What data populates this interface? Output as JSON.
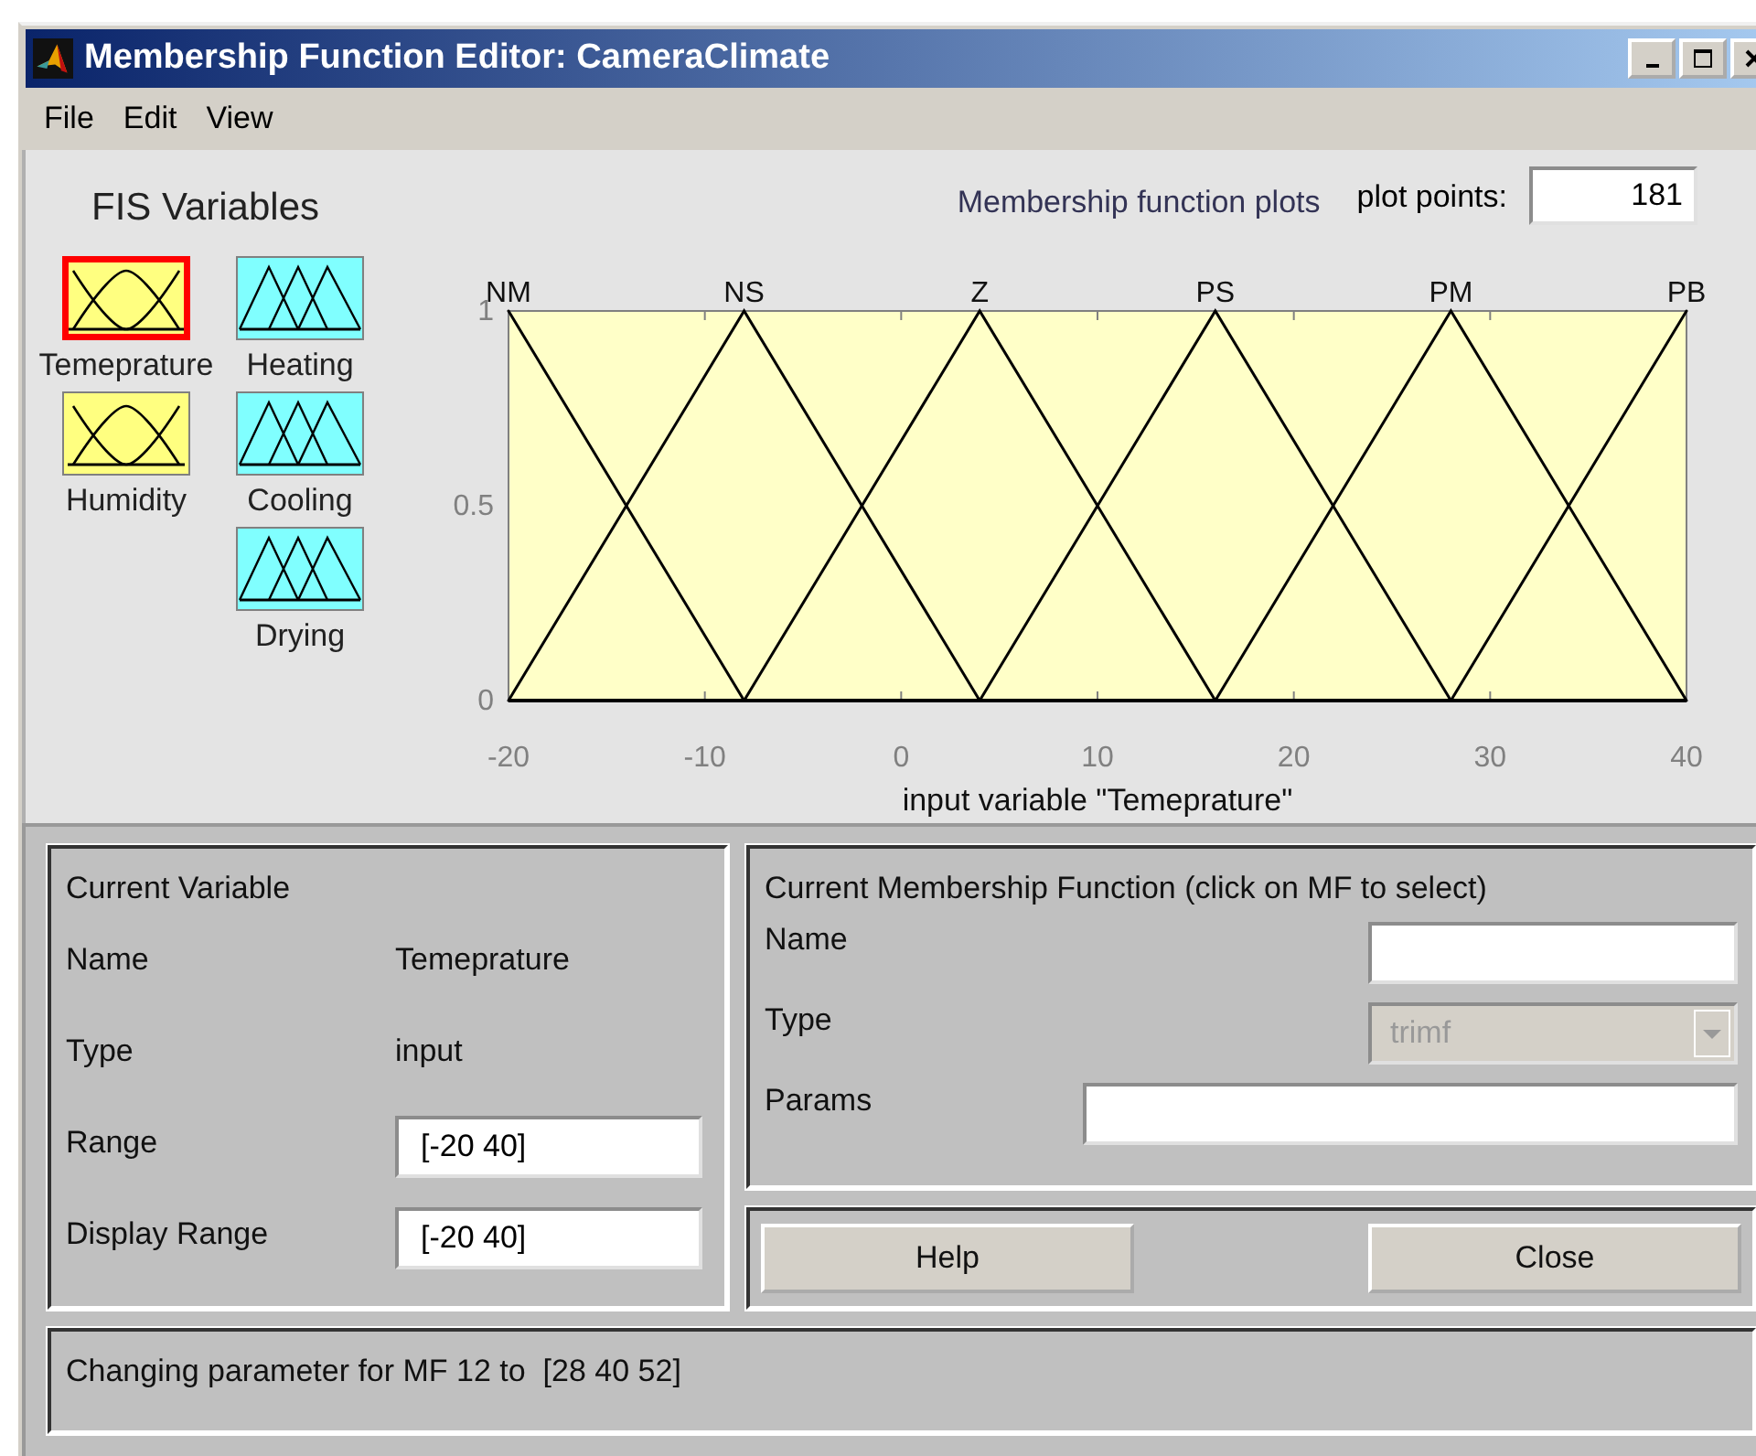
{
  "window": {
    "title": "Membership Function Editor: CameraClimate"
  },
  "menu": [
    {
      "label": "File"
    },
    {
      "label": "Edit"
    },
    {
      "label": "View"
    }
  ],
  "fis_variables": {
    "title": "FIS Variables",
    "items": [
      {
        "name": "Temeprature",
        "kind": "input",
        "selected": true
      },
      {
        "name": "Heating",
        "kind": "output",
        "selected": false
      },
      {
        "name": "Humidity",
        "kind": "input",
        "selected": false
      },
      {
        "name": "Cooling",
        "kind": "output",
        "selected": false
      },
      {
        "name": "Drying",
        "kind": "output",
        "selected": false
      }
    ]
  },
  "plot": {
    "title": "Membership function plots",
    "plot_points_label": "plot points:",
    "plot_points": "181",
    "chart_data": {
      "type": "line",
      "xlabel": "input variable \"Temeprature\"",
      "x": [
        -20,
        -8,
        4,
        16,
        28,
        40
      ],
      "series": [
        {
          "name": "NM",
          "color": "#000000",
          "values": [
            1,
            0,
            null,
            null,
            null,
            null
          ]
        },
        {
          "name": "NS",
          "color": "#000000",
          "values": [
            0,
            1,
            0,
            null,
            null,
            null
          ]
        },
        {
          "name": "Z",
          "color": "#000000",
          "values": [
            null,
            0,
            1,
            0,
            null,
            null
          ]
        },
        {
          "name": "PS",
          "color": "#000000",
          "values": [
            null,
            null,
            0,
            1,
            0,
            null
          ]
        },
        {
          "name": "PM",
          "color": "#000000",
          "values": [
            null,
            null,
            null,
            0,
            1,
            0
          ]
        },
        {
          "name": "PB",
          "color": "#000000",
          "values": [
            null,
            null,
            null,
            null,
            0,
            1
          ]
        }
      ],
      "xlim": [
        -20,
        40
      ],
      "ylim": [
        0,
        1
      ],
      "xticks": [
        -20,
        -10,
        0,
        10,
        20,
        30,
        40
      ],
      "yticks": [
        0,
        0.5,
        1
      ]
    }
  },
  "current_variable": {
    "title": "Current Variable",
    "name_label": "Name",
    "name": "Temeprature",
    "type_label": "Type",
    "type": "input",
    "range_label": "Range",
    "range": "[-20 40]",
    "display_range_label": "Display Range",
    "display_range": "[-20 40]"
  },
  "current_mf": {
    "title": "Current Membership Function (click on MF to select)",
    "name_label": "Name",
    "type_label": "Type",
    "type": "trimf",
    "type_disabled": true,
    "params_label": "Params"
  },
  "buttons": [
    {
      "label": "Help"
    },
    {
      "label": "Close"
    }
  ],
  "status": "Changing parameter for MF 12 to  [28 40 52]"
}
